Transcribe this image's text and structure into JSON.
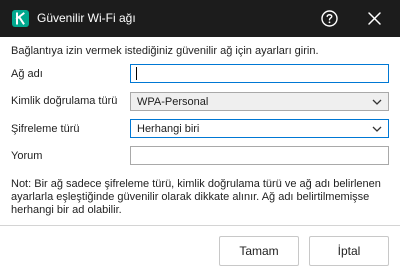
{
  "window": {
    "title": "Güvenilir Wi-Fi ağı",
    "logo_icon": "kaspersky-logo-icon",
    "help_icon": "help-icon",
    "close_icon": "close-icon",
    "brand_color": "#00a88e"
  },
  "form": {
    "intro": "Bağlantıya izin vermek istediğiniz güvenilir ağ için ayarları girin.",
    "network_name": {
      "label": "Ağ adı",
      "value": ""
    },
    "auth_type": {
      "label": "Kimlik doğrulama türü",
      "value": "WPA-Personal"
    },
    "encryption": {
      "label": "Şifreleme türü",
      "value": "Herhangi biri"
    },
    "comment": {
      "label": "Yorum",
      "value": ""
    }
  },
  "note": "Not: Bir ağ sadece şifreleme türü, kimlik doğrulama türü ve ağ adı belirlenen ayarlarla eşleştiğinde güvenilir olarak dikkate alınır. Ağ adı belirtilmemişse herhangi bir ad olabilir.",
  "footer": {
    "ok_label": "Tamam",
    "cancel_label": "İptal"
  }
}
